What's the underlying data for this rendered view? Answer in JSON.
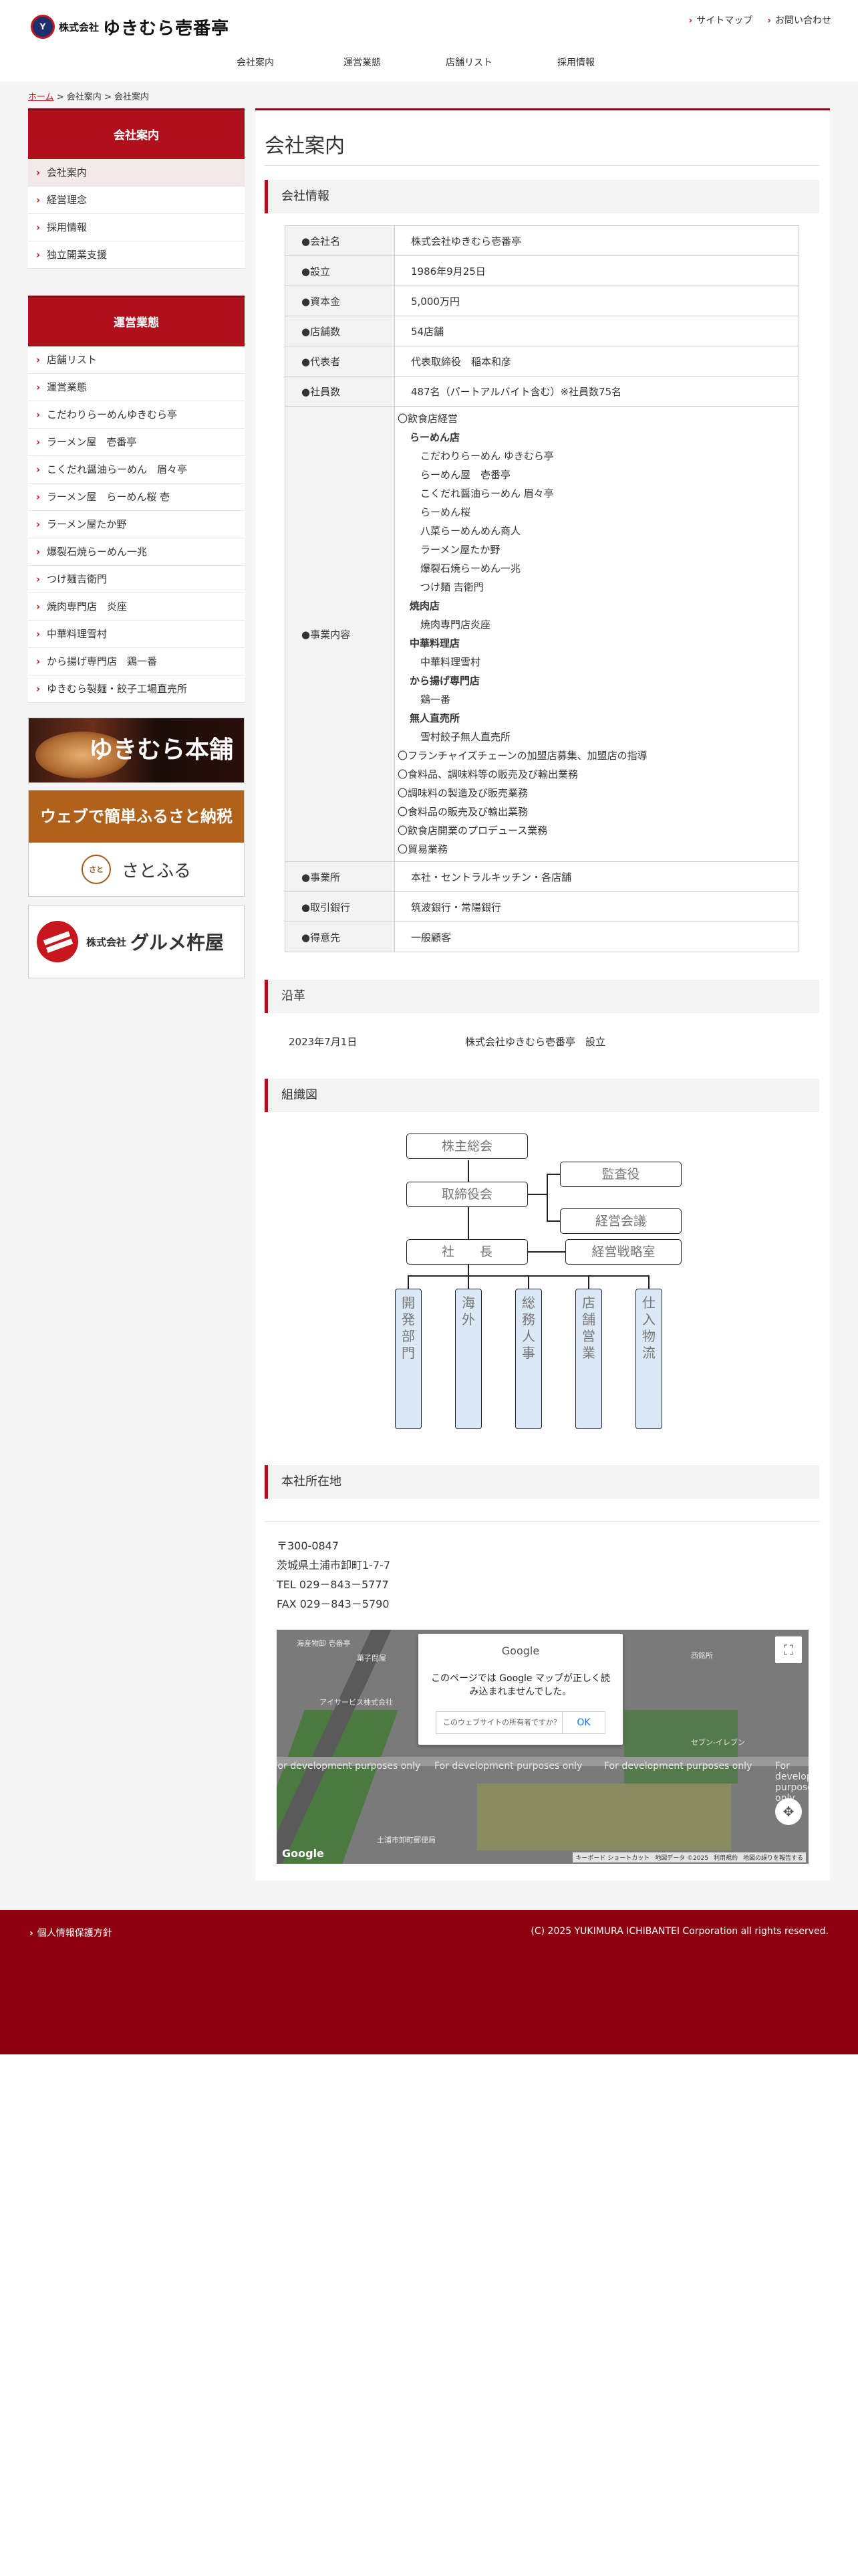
{
  "header": {
    "logo_company": "株式会社",
    "logo_name": "ゆきむら壱番亭",
    "util_links": [
      "サイトマップ",
      "お問い合わせ"
    ],
    "gnav": [
      "会社案内",
      "運営業態",
      "店舗リスト",
      "採用情報"
    ]
  },
  "breadcrumb": {
    "home": "ホーム",
    "sep": " > ",
    "level1": "会社案内",
    "level2": "会社案内"
  },
  "sidebar": {
    "group1": {
      "heading": "会社案内",
      "items": [
        "会社案内",
        "経営理念",
        "採用情報",
        "独立開業支援"
      ]
    },
    "group2": {
      "heading": "運営業態",
      "items": [
        "店舗リスト",
        "運営業態",
        "こだわりらーめんゆきむら亭",
        "ラーメン屋　壱番亭",
        "こくだれ醤油らーめん　眉々亭",
        "ラーメン屋　らーめん桜 壱",
        "ラーメン屋たか野",
        "爆裂石焼らーめん一兆",
        "つけ麺吉衛門",
        "焼肉専門店　炎座",
        "中華料理雪村",
        "から揚げ専門店　鶏一番",
        "ゆきむら製麺・餃子工場直売所"
      ]
    },
    "banners": {
      "b2_top": "ウェブで簡単ふるさと納税",
      "b2_seal": "さと",
      "b2_label": "さとふる",
      "b3_company": "株式会社",
      "b3_name": "グルメ杵屋"
    }
  },
  "main": {
    "title": "会社案内",
    "sections": {
      "info": "会社情報",
      "history": "沿革",
      "org": "組織図",
      "address": "本社所在地"
    },
    "info_rows": [
      {
        "label": "●会社名",
        "value": "株式会社ゆきむら壱番亭"
      },
      {
        "label": "●設立",
        "value": "1986年9月25日"
      },
      {
        "label": "●資本金",
        "value": "5,000万円"
      },
      {
        "label": "●店舗数",
        "value": "54店舗"
      },
      {
        "label": "●代表者",
        "value": "代表取締役　稲本和彦"
      },
      {
        "label": "●社員数",
        "value": "487名（パートアルバイト含む）※社員数75名"
      }
    ],
    "business": {
      "label": "●事業内容",
      "lines": [
        {
          "t": "〇飲食店経営",
          "i": 0,
          "b": false
        },
        {
          "t": "らーめん店",
          "i": 1,
          "b": true
        },
        {
          "t": "こだわりらーめん ゆきむら亭",
          "i": 2,
          "b": false
        },
        {
          "t": "らーめん屋　壱番亭",
          "i": 2,
          "b": false
        },
        {
          "t": "こくだれ醤油らーめん 眉々亭",
          "i": 2,
          "b": false
        },
        {
          "t": "らーめん桜",
          "i": 2,
          "b": false
        },
        {
          "t": "八菜らーめんめん商人",
          "i": 2,
          "b": false
        },
        {
          "t": "ラーメン屋たか野",
          "i": 2,
          "b": false
        },
        {
          "t": "爆裂石焼らーめん一兆",
          "i": 2,
          "b": false
        },
        {
          "t": "つけ麺 吉衛門",
          "i": 2,
          "b": false
        },
        {
          "t": "焼肉店",
          "i": 1,
          "b": true
        },
        {
          "t": "焼肉専門店炎座",
          "i": 2,
          "b": false
        },
        {
          "t": "中華料理店",
          "i": 1,
          "b": true
        },
        {
          "t": "中華料理雪村",
          "i": 2,
          "b": false
        },
        {
          "t": "から揚げ専門店",
          "i": 1,
          "b": true
        },
        {
          "t": "鶏一番",
          "i": 2,
          "b": false
        },
        {
          "t": "無人直売所",
          "i": 1,
          "b": true
        },
        {
          "t": "雪村餃子無人直売所",
          "i": 2,
          "b": false
        },
        {
          "t": "〇フランチャイズチェーンの加盟店募集、加盟店の指導",
          "i": 0,
          "b": false
        },
        {
          "t": "〇食料品、調味料等の販売及び輸出業務",
          "i": 0,
          "b": false
        },
        {
          "t": "〇調味料の製造及び販売業務",
          "i": 0,
          "b": false
        },
        {
          "t": "〇食料品の販売及び輸出業務",
          "i": 0,
          "b": false
        },
        {
          "t": "〇飲食店開業のプロデュース業務",
          "i": 0,
          "b": false
        },
        {
          "t": "〇貿易業務",
          "i": 0,
          "b": false
        }
      ]
    },
    "info_rows_after": [
      {
        "label": "●事業所",
        "value": "本社・セントラルキッチン・各店舗"
      },
      {
        "label": "●取引銀行",
        "value": "筑波銀行・常陽銀行"
      },
      {
        "label": "●得意先",
        "value": "一般顧客"
      }
    ],
    "history": [
      {
        "date": "2023年7月1日",
        "event": "株式会社ゆきむら壱番亭　設立"
      }
    ],
    "org_chart": {
      "shareholders": "株主総会",
      "board": "取締役会",
      "auditor": "監査役",
      "mgmt_meeting": "経営会議",
      "president": "社　　長",
      "strategy": "経営戦略室",
      "departments": [
        "開発部門",
        "海外",
        "総務人事",
        "店舗営業",
        "仕入物流"
      ]
    },
    "address": {
      "zip": "〒300-0847",
      "street": "茨城県土浦市卸町1-7-7",
      "tel": "TEL 029－843－5777",
      "fax": "FAX 029－843－5790"
    },
    "map": {
      "google": "Google",
      "message": "このページでは Google マップが正しく読み込まれませんでした。",
      "question": "このウェブサイトの所有者ですか？",
      "ok": "OK",
      "dev_text": "For development purposes only",
      "logo": "Google",
      "attr": [
        "キーボード ショートカット",
        "地図データ ©2025",
        "利用規約",
        "地図の誤りを報告する"
      ],
      "places": [
        "海産物卸 壱番亭",
        "菓子問屋",
        "アイサービス株式会社",
        "西銘所",
        "土浦市卸町郵便局",
        "セブン-イレブン"
      ]
    }
  },
  "footer": {
    "link": "個人情報保護方針",
    "copyright": "(C) 2025 YUKIMURA ICHIBANTEI Corporation all rights reserved."
  },
  "colors": {
    "brand_red": "#b0101c",
    "footer": "#8e0010",
    "org_box_fill": "#dbe8f5"
  }
}
